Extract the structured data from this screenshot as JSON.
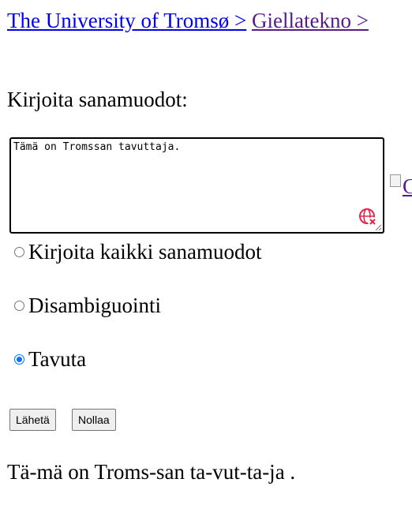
{
  "breadcrumb": {
    "link1": "The University of Tromsø >",
    "link2": "Giellatekno >"
  },
  "form": {
    "prompt": "Kirjoita sanamuodot:",
    "textarea_value": "Tämä on Tromssan tavuttaja.",
    "broken_image_alt": "G",
    "options": [
      {
        "label": "Kirjoita kaikki sanamuodot",
        "checked": false
      },
      {
        "label": "Disambiguointi",
        "checked": false
      },
      {
        "label": "Tavuta",
        "checked": true
      }
    ],
    "submit_label": "Lähetä",
    "reset_label": "Nollaa"
  },
  "result": {
    "text": "Tä-mä on Troms-san ta-vut-ta-ja ."
  },
  "icons": {
    "spellcheck": "globe-x-icon",
    "resize": "resize-handle-icon"
  },
  "colors": {
    "link": "#0000ee",
    "visited_link": "#551a8b",
    "radio_checked": "#0075ff",
    "spell_icon": "#e2264d"
  }
}
